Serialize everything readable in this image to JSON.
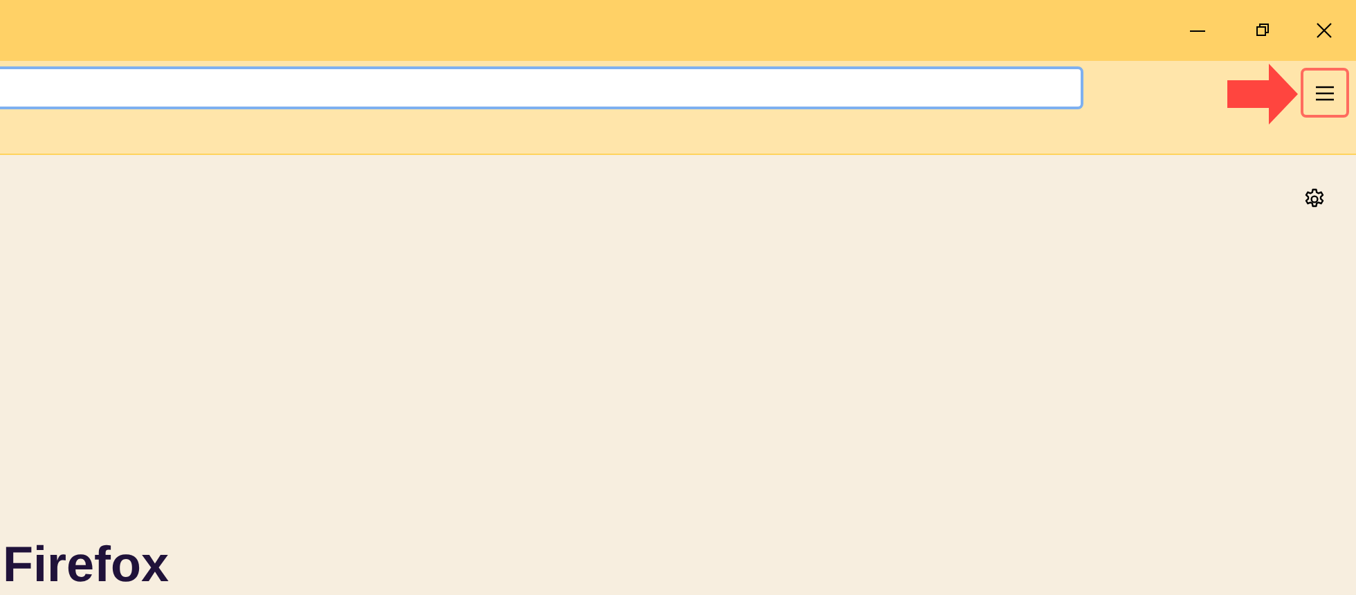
{
  "window_controls": [
    {
      "kind": "minimize"
    },
    {
      "kind": "restore"
    },
    {
      "kind": "close"
    }
  ],
  "toolbar": {
    "annotation": {
      "kind": "arrow"
    },
    "menu_button": {
      "highlighted": true
    }
  },
  "content": {
    "settings": {
      "kind": "gear"
    },
    "heading": "Firefox"
  }
}
